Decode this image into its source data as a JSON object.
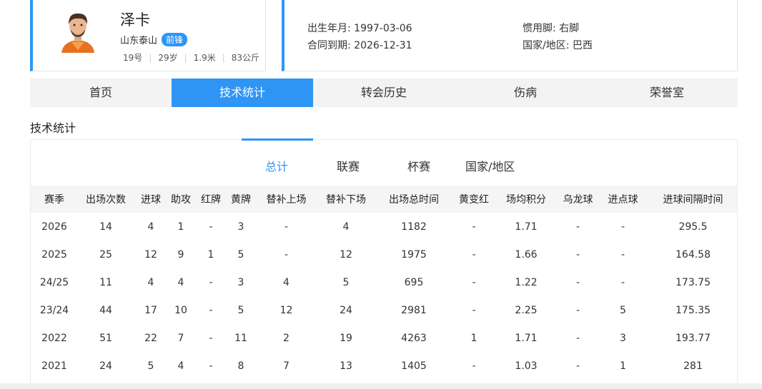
{
  "player": {
    "name": "泽卡",
    "team": "山东泰山",
    "position": "前锋",
    "number": "19号",
    "age": "29岁",
    "height": "1.9米",
    "weight": "83公斤",
    "avatar_icon": "player-portrait"
  },
  "info": {
    "birth": "出生年月: 1997-03-06",
    "contract": "合同到期: 2026-12-31",
    "foot": "惯用脚: 右脚",
    "nation": "国家/地区: 巴西"
  },
  "tabs": [
    "首页",
    "技术统计",
    "转会历史",
    "伤病",
    "荣誉室"
  ],
  "active_tab": "技术统计",
  "section_title": "技术统计",
  "subtabs": [
    "总计",
    "联赛",
    "杯赛",
    "国家/地区"
  ],
  "active_subtab": "总计",
  "table": {
    "headers": [
      "赛季",
      "出场次数",
      "进球",
      "助攻",
      "红牌",
      "黄牌",
      "替补上场",
      "替补下场",
      "出场总时间",
      "黄变红",
      "场均积分",
      "乌龙球",
      "进点球",
      "进球间隔时间"
    ],
    "rows": [
      [
        "2026",
        "14",
        "4",
        "1",
        "-",
        "3",
        "-",
        "4",
        "1182",
        "-",
        "1.71",
        "-",
        "-",
        "295.5"
      ],
      [
        "2025",
        "25",
        "12",
        "9",
        "1",
        "5",
        "-",
        "12",
        "1975",
        "-",
        "1.66",
        "-",
        "-",
        "164.58"
      ],
      [
        "24/25",
        "11",
        "4",
        "4",
        "-",
        "3",
        "4",
        "5",
        "695",
        "-",
        "1.22",
        "-",
        "-",
        "173.75"
      ],
      [
        "23/24",
        "44",
        "17",
        "10",
        "-",
        "5",
        "12",
        "24",
        "2981",
        "-",
        "2.25",
        "-",
        "5",
        "175.35"
      ],
      [
        "2022",
        "51",
        "22",
        "7",
        "-",
        "11",
        "2",
        "19",
        "4263",
        "1",
        "1.71",
        "-",
        "3",
        "193.77"
      ],
      [
        "2021",
        "24",
        "5",
        "4",
        "-",
        "8",
        "7",
        "13",
        "1405",
        "-",
        "1.03",
        "-",
        "1",
        "281"
      ]
    ]
  },
  "colors": {
    "accent": "#2f95f5",
    "tab_bg": "#f3f3f3",
    "header_bg": "#f5f5f5"
  }
}
